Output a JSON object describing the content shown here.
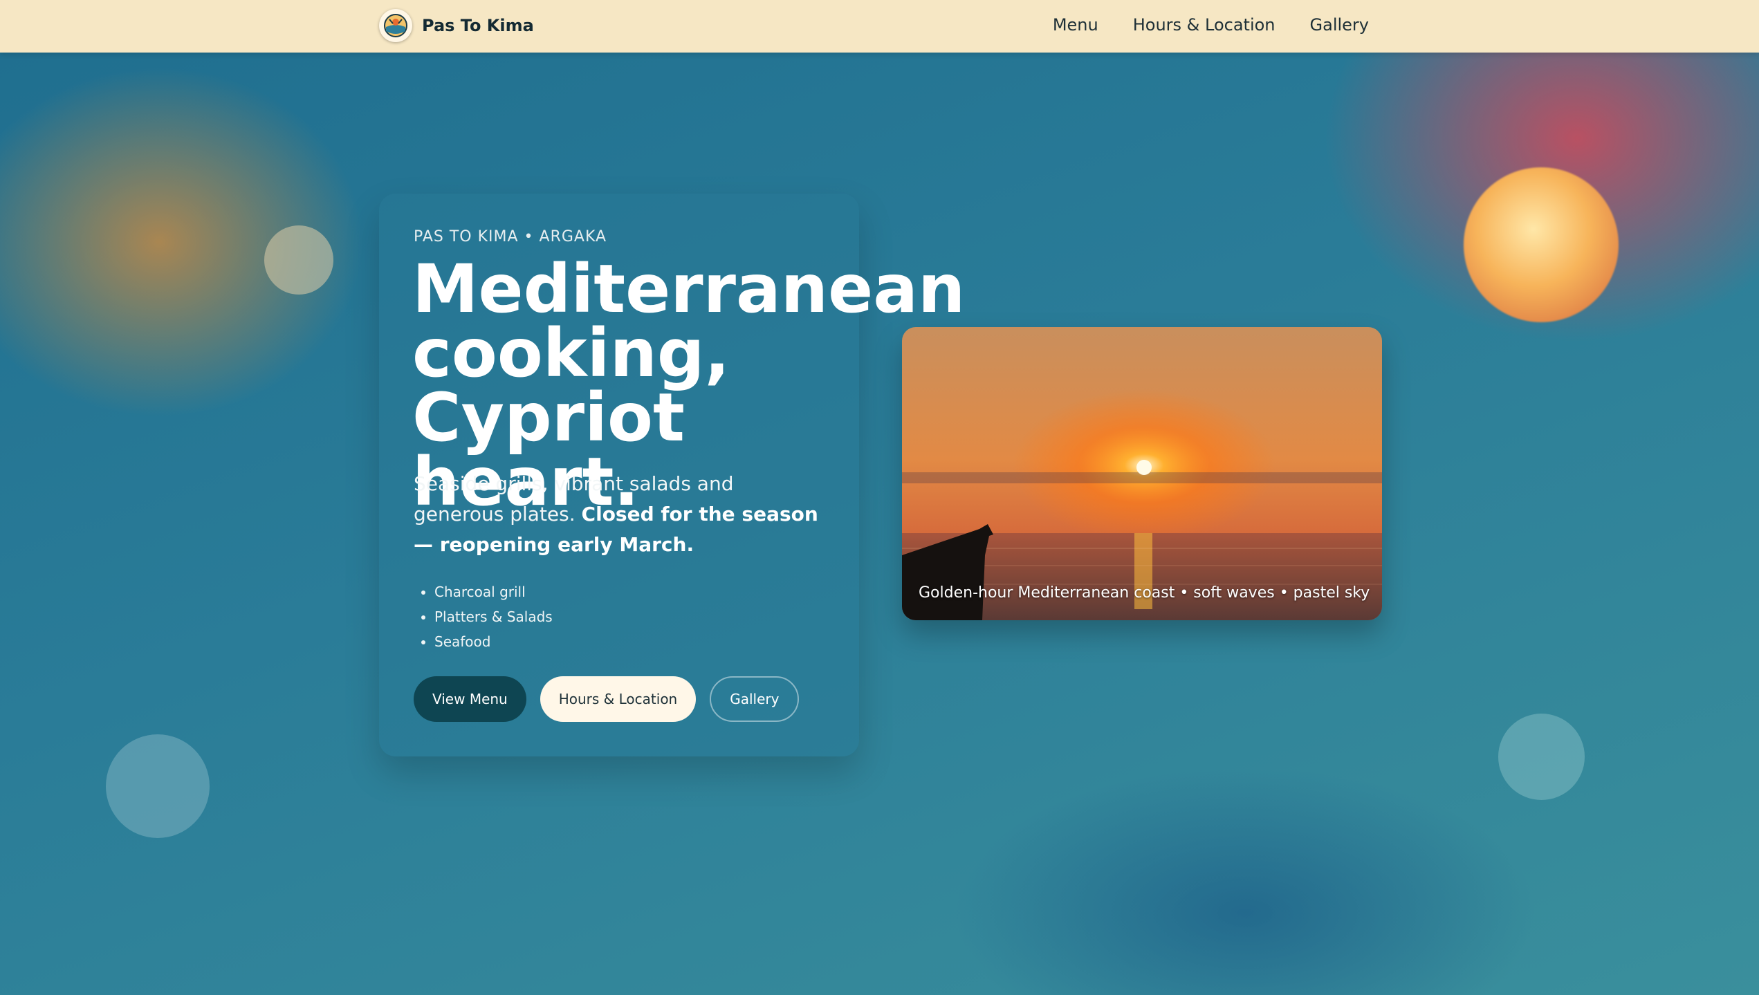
{
  "brand": {
    "name": "Pas To Kima",
    "logo_icon": "restaurant-logo-icon"
  },
  "nav": {
    "items": [
      "Menu",
      "Hours & Location",
      "Gallery"
    ]
  },
  "hero": {
    "eyebrow": "PAS TO KIMA • ARGAKA",
    "headline_lines": [
      "Mediterranean",
      "cooking,",
      "Cypriot heart."
    ],
    "lede_plain": "Seaside grills, vibrant salads and generous plates. ",
    "lede_bold": "Closed for the season — reopening early March.",
    "features": [
      "Charcoal grill",
      "Platters & Salads",
      "Seafood"
    ],
    "buttons": {
      "primary": "View Menu",
      "secondary": "Hours & Location",
      "tertiary": "Gallery"
    }
  },
  "photo": {
    "caption": "Golden-hour Mediterranean coast • soft waves • pastel sky"
  },
  "colors": {
    "nav_bg": "#f6e7c4",
    "primary_button": "#0e4552",
    "light_button": "#fff7e8",
    "page_teal": "#2a7c98"
  }
}
